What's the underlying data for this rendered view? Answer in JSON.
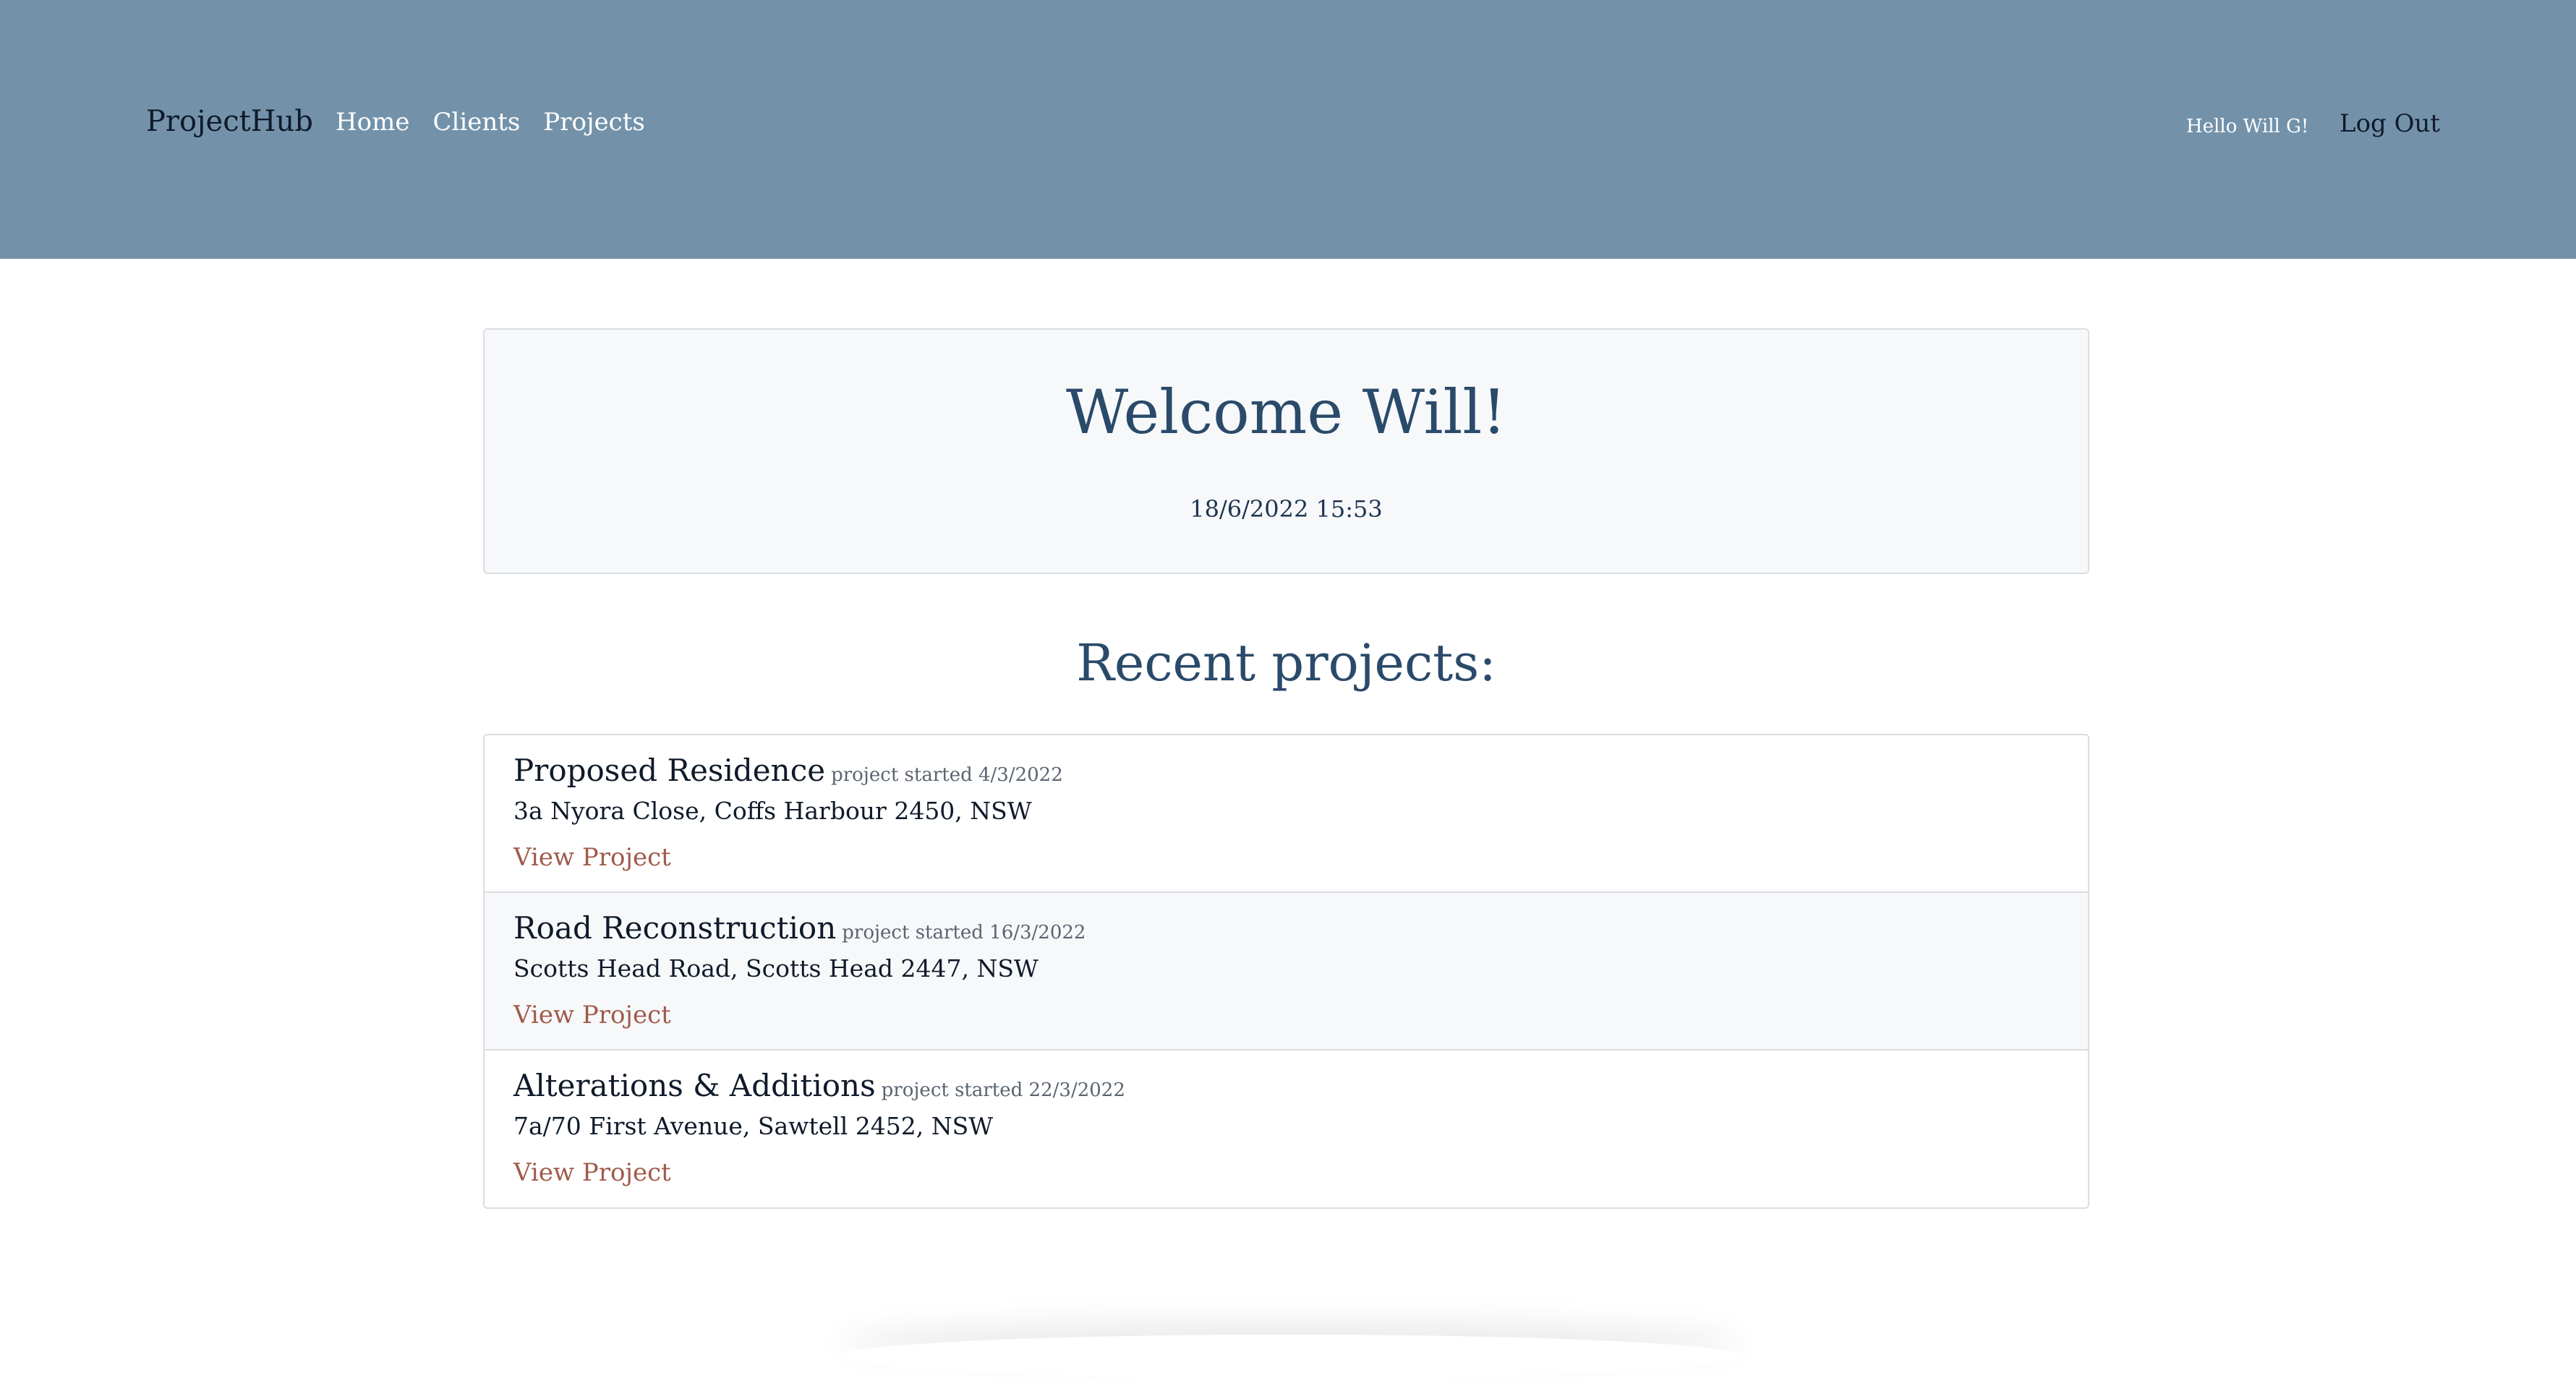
{
  "navbar": {
    "brand": "ProjectHub",
    "links": [
      {
        "label": "Home"
      },
      {
        "label": "Clients"
      },
      {
        "label": "Projects"
      }
    ],
    "greeting": "Hello Will G!",
    "logout_label": "Log Out"
  },
  "welcome": {
    "title": "Welcome Will!",
    "datetime": "18/6/2022 15:53"
  },
  "recent": {
    "title": "Recent projects:",
    "projects": [
      {
        "name": "Proposed Residence",
        "started": "project started 4/3/2022",
        "address": "3a Nyora Close, Coffs Harbour 2450, NSW",
        "link_label": "View Project"
      },
      {
        "name": "Road Reconstruction",
        "started": "project started 16/3/2022",
        "address": "Scotts Head Road, Scotts Head 2447, NSW",
        "link_label": "View Project"
      },
      {
        "name": "Alterations & Additions",
        "started": "project started 22/3/2022",
        "address": "7a/70 First Avenue, Sawtell 2452, NSW",
        "link_label": "View Project"
      }
    ]
  },
  "colors": {
    "navbar_bg": "#7392aa",
    "heading": "#2a4a6a",
    "link_accent": "#a05a4a"
  }
}
